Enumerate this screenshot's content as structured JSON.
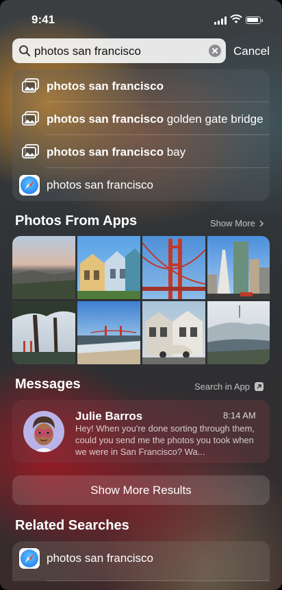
{
  "status": {
    "time": "9:41"
  },
  "search": {
    "query": "photos san francisco",
    "cancel_label": "Cancel"
  },
  "suggestions": [
    {
      "bold": "photos san francisco",
      "rest": "",
      "icon": "photos-icon"
    },
    {
      "bold": "photos san francisco",
      "rest": " golden gate bridge",
      "icon": "photos-icon"
    },
    {
      "bold": "photos san francisco",
      "rest": " bay",
      "icon": "photos-icon"
    },
    {
      "bold": "",
      "rest": "photos san francisco",
      "icon": "safari-icon"
    }
  ],
  "photos_section": {
    "title": "Photos From Apps",
    "link": "Show More"
  },
  "messages_section": {
    "title": "Messages",
    "link": "Search in App",
    "message": {
      "sender": "Julie Barros",
      "time": "8:14 AM",
      "body": "Hey! When you're done sorting through them, could you send me the photos you took when we were in San Francisco? Wa..."
    }
  },
  "show_more_results": "Show More Results",
  "related_section": {
    "title": "Related Searches",
    "items": [
      {
        "text": "photos san francisco",
        "icon": "safari-icon"
      }
    ]
  },
  "colors": {
    "accent_blue": "#1a73e8",
    "sky": "#6fa8dc",
    "bridge_red": "#c0392b"
  }
}
